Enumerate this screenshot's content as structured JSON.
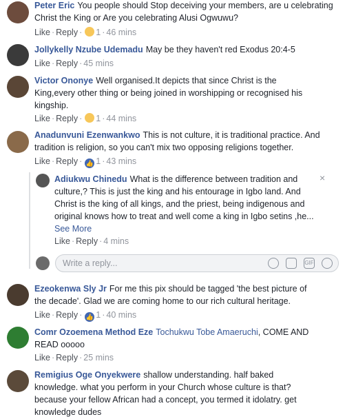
{
  "comments": [
    {
      "name": "Peter Eric",
      "text": "You people should Stop deceiving your members, are u celebrating Christ the King or Are you celebrating Alusi Ogwuwu?",
      "like": "Like",
      "reply": "Reply",
      "reaction": "sad-emoji",
      "count": "1",
      "time": "46 mins"
    },
    {
      "name": "Jollykelly Nzube Udemadu",
      "text": "May be they haven't red Exodus 20:4-5",
      "like": "Like",
      "reply": "Reply",
      "time": "45 mins"
    },
    {
      "name": "Victor Ononye",
      "text": "Well organised.It depicts that since Christ is the King,every other thing or being joined in worshipping or recognised his kingship.",
      "like": "Like",
      "reply": "Reply",
      "reaction": "wow-emoji",
      "count": "1",
      "time": "44 mins"
    },
    {
      "name": "Anadunvuni Ezenwankwo",
      "text": "This is not culture, it is traditional practice. And tradition is religion, so you can't mix two opposing religions together.",
      "like": "Like",
      "reply": "Reply",
      "reaction": "like-icon",
      "count": "1",
      "time": "43 mins"
    },
    {
      "name": "Adiukwu Chinedu",
      "text": "What is the difference between tradition and culture,? This is just the king and his entourage in Igbo land. And Christ is the king of all kings, and the priest, being indigenous and original knows how to treat and well come a king in Igbo setins ,he...",
      "see_more": "See More",
      "like": "Like",
      "reply": "Reply",
      "time": "4 mins"
    },
    {
      "name": "Ezeokenwa Sly Jr",
      "text": "For me this pix should be tagged 'the best picture of the decade'. Glad we are coming home to our rich cultural heritage.",
      "like": "Like",
      "reply": "Reply",
      "reaction": "like-icon",
      "count": "1",
      "time": "40 mins"
    },
    {
      "name": "Comr Ozoemena Method Eze",
      "tag": "Tochukwu Tobe Amaeruchi",
      "text": ", COME AND READ ooooo",
      "like": "Like",
      "reply": "Reply",
      "time": "25 mins"
    },
    {
      "name": "Remigius Oge Onyekwere",
      "text": "shallow understanding. half baked knowledge. what you perform in your Church whose culture is that? because your fellow African had a concept, you termed it idolatry. get knowledge dudes"
    }
  ],
  "reply_box": {
    "placeholder": "Write a reply...",
    "gif_label": "GIF"
  },
  "close_symbol": "×",
  "colors": {
    "name": "#385898",
    "meta": "#90949c",
    "like_blue": "#4267b2"
  }
}
